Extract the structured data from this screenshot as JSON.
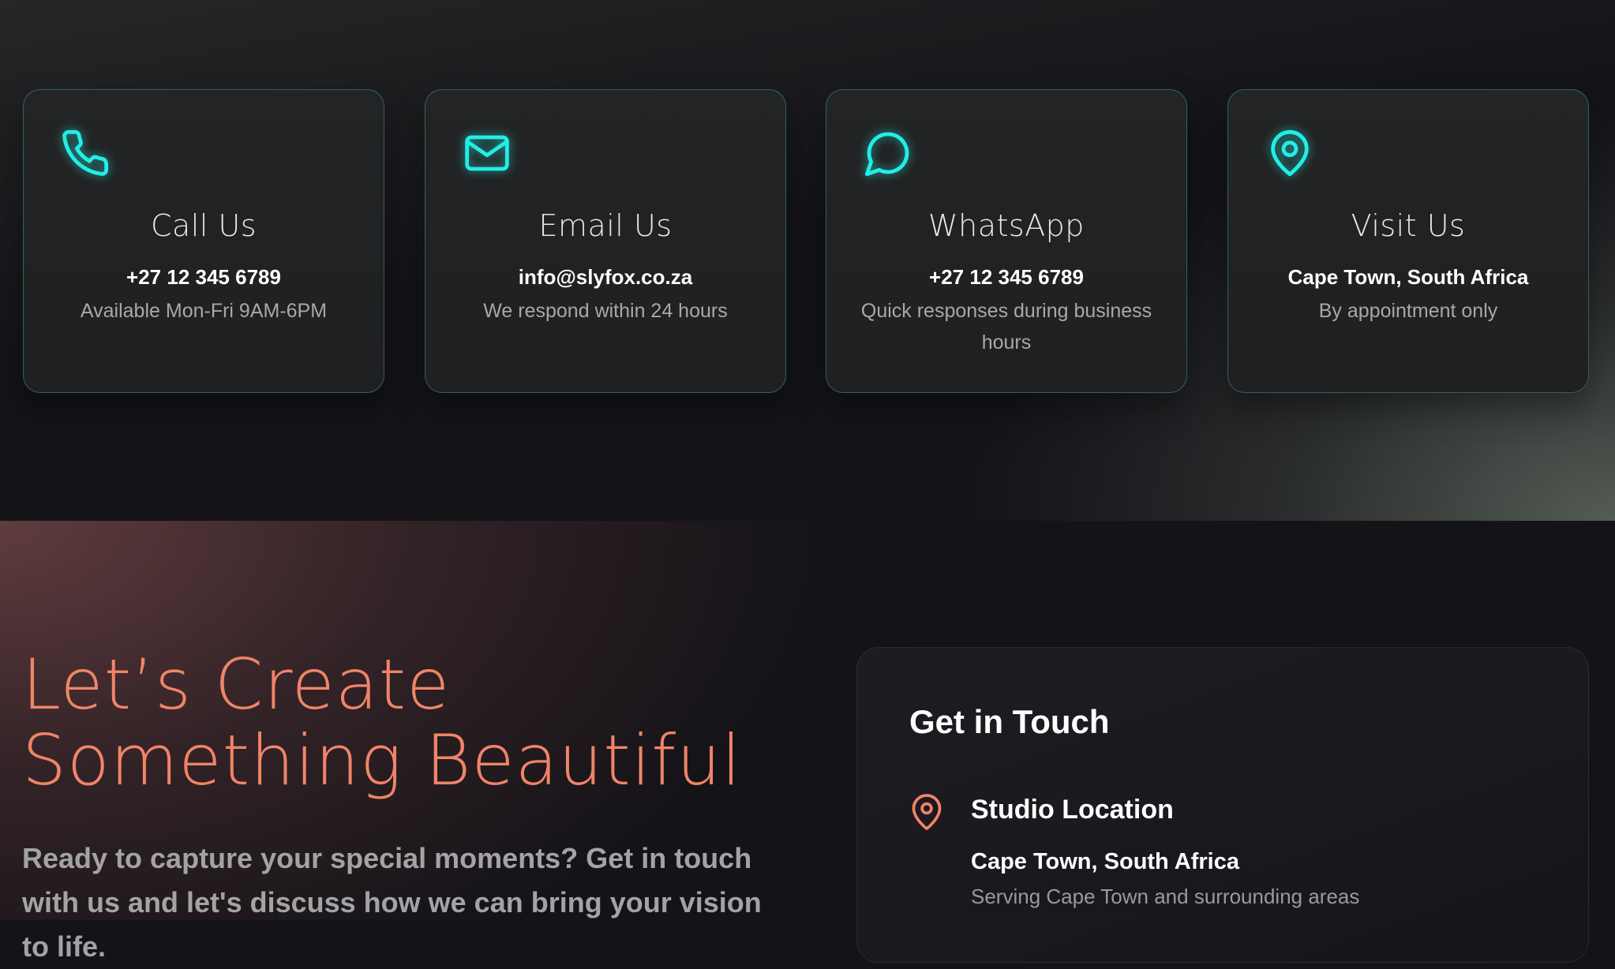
{
  "contact_cards": [
    {
      "icon": "phone-icon",
      "title": "Call Us",
      "main": "+27 12 345 6789",
      "sub": "Available Mon-Fri 9AM-6PM"
    },
    {
      "icon": "mail-icon",
      "title": "Email Us",
      "main": "info@slyfox.co.za",
      "sub": "We respond within 24 hours"
    },
    {
      "icon": "chat-bubble-icon",
      "title": "WhatsApp",
      "main": "+27 12 345 6789",
      "sub": "Quick responses during business hours"
    },
    {
      "icon": "map-pin-icon",
      "title": "Visit Us",
      "main": "Cape Town, South Africa",
      "sub": "By appointment only"
    }
  ],
  "hero": {
    "title_line1": "Let’s Create",
    "title_line2": "Something Beautiful",
    "text": "Ready to capture your special moments? Get in touch with us and let's discuss how we can bring your vision to life."
  },
  "get_in_touch": {
    "title": "Get in Touch",
    "location": {
      "icon": "map-pin-icon",
      "label": "Studio Location",
      "main": "Cape Town, South Africa",
      "sub": "Serving Cape Town and surrounding areas"
    }
  },
  "colors": {
    "card_accent": "#22eee6",
    "hero_accent": "#f08468"
  }
}
